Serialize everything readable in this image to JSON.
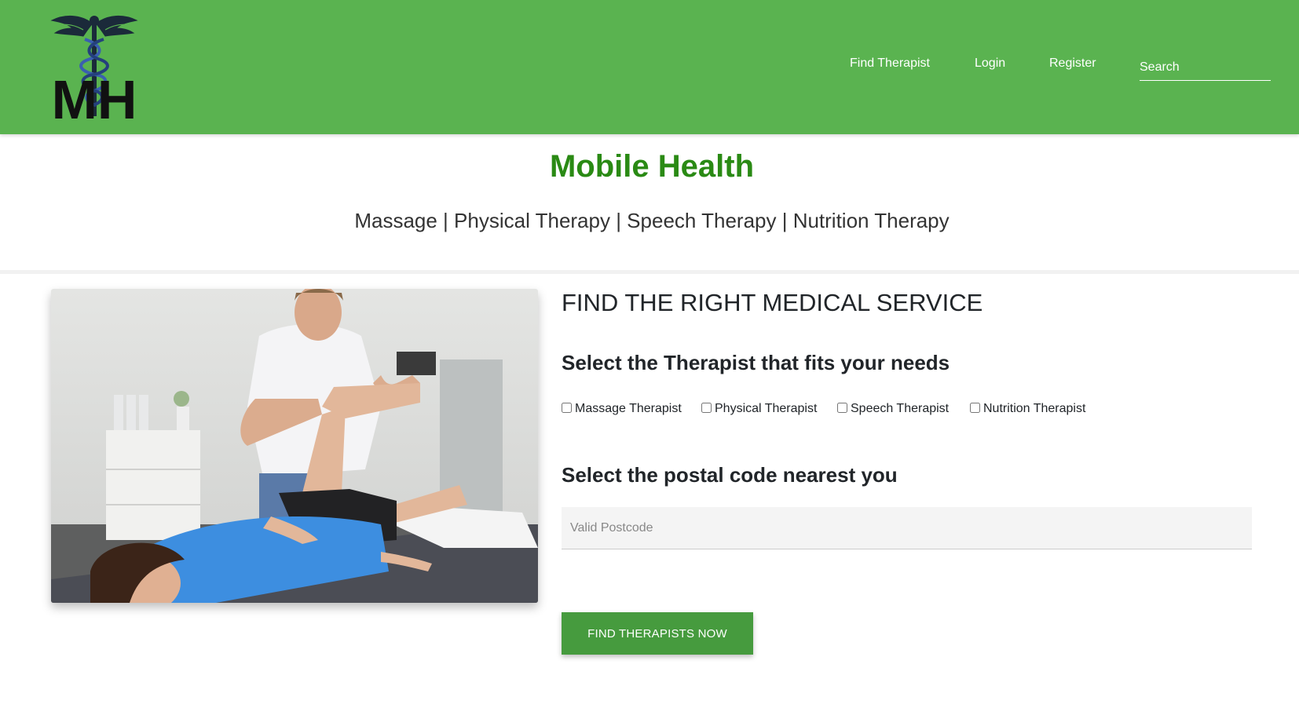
{
  "header": {
    "logo_letters": "MH",
    "nav": {
      "find_therapist": "Find Therapist",
      "login": "Login",
      "register": "Register"
    },
    "search": {
      "placeholder": "Search",
      "value": ""
    },
    "icons": {
      "logo": "caduceus-icon"
    }
  },
  "brand": {
    "title": "Mobile Health",
    "services": "Massage | Physical Therapy | Speech Therapy | Nutrition Therapy"
  },
  "main": {
    "heading": "FIND THE RIGHT MEDICAL SERVICE",
    "therapist_prompt": "Select the Therapist that fits your needs",
    "therapists": [
      {
        "label": "Massage Therapist",
        "checked": false
      },
      {
        "label": "Physical Therapist",
        "checked": false
      },
      {
        "label": "Speech Therapist",
        "checked": false
      },
      {
        "label": "Nutrition Therapist",
        "checked": false
      }
    ],
    "postal_prompt": "Select the postal code nearest you",
    "postcode": {
      "placeholder": "Valid Postcode",
      "value": ""
    },
    "submit_label": "FIND THERAPISTS NOW"
  },
  "colors": {
    "navbar": "#5ab350",
    "brand_title": "#2a8a14",
    "button": "#469b3e"
  }
}
